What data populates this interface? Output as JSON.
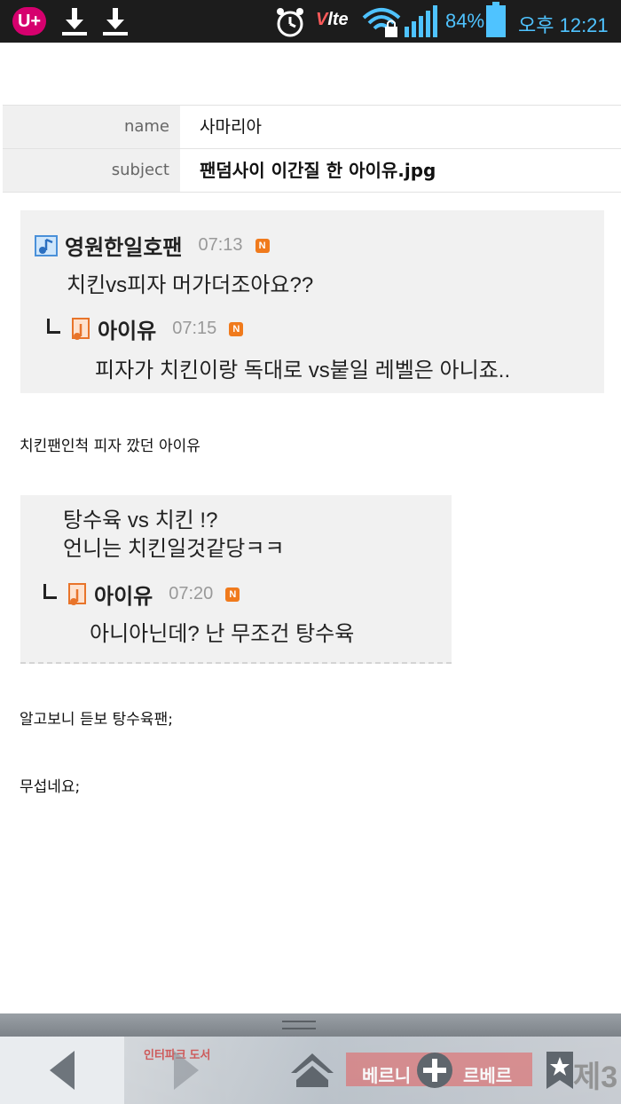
{
  "status_bar": {
    "carrier": "U+",
    "network": "lte",
    "battery": "84%",
    "time": "오후 12:21",
    "icons": [
      "download-icon",
      "download-icon",
      "alarm-icon",
      "volte-icon",
      "wifi-lock-icon",
      "signal-icon",
      "battery-icon"
    ]
  },
  "post": {
    "name_label": "name",
    "name_value": "사마리아",
    "subject_label": "subject",
    "subject_value": "팬덤사이 이간질 한 아이유.jpg"
  },
  "quote1": {
    "author": "영원한일호팬",
    "time": "07:13",
    "text": "치킨vs피자 머가더조아요??",
    "reply": {
      "author": "아이유",
      "time": "07:15",
      "text": "피자가 치킨이랑 독대로 vs붙일 레벨은 아니죠.."
    },
    "badge": "N"
  },
  "line1": "치킨팬인척 피자 깠던 아이유",
  "quote2": {
    "line_a": "탕수육 vs 치킨 !?",
    "line_b": "언니는 치킨일것같당ㅋㅋ",
    "reply": {
      "author": "아이유",
      "time": "07:20",
      "text": "아니아닌데? 난 무조건 탕수육"
    },
    "badge": "N"
  },
  "line2": "알고보니 듣보 탕수육팬;",
  "line3": "무섭네요;",
  "ad": {
    "text_a": "인터파크 도서",
    "text_b": "베르니",
    "text_c": "르베르",
    "text_d": "제3"
  },
  "colors": {
    "statusbar_bg": "#1c1c1c",
    "status_accent": "#4fc3ff",
    "badge": "#f07a1c",
    "quote_bg": "#f1f1f1"
  }
}
